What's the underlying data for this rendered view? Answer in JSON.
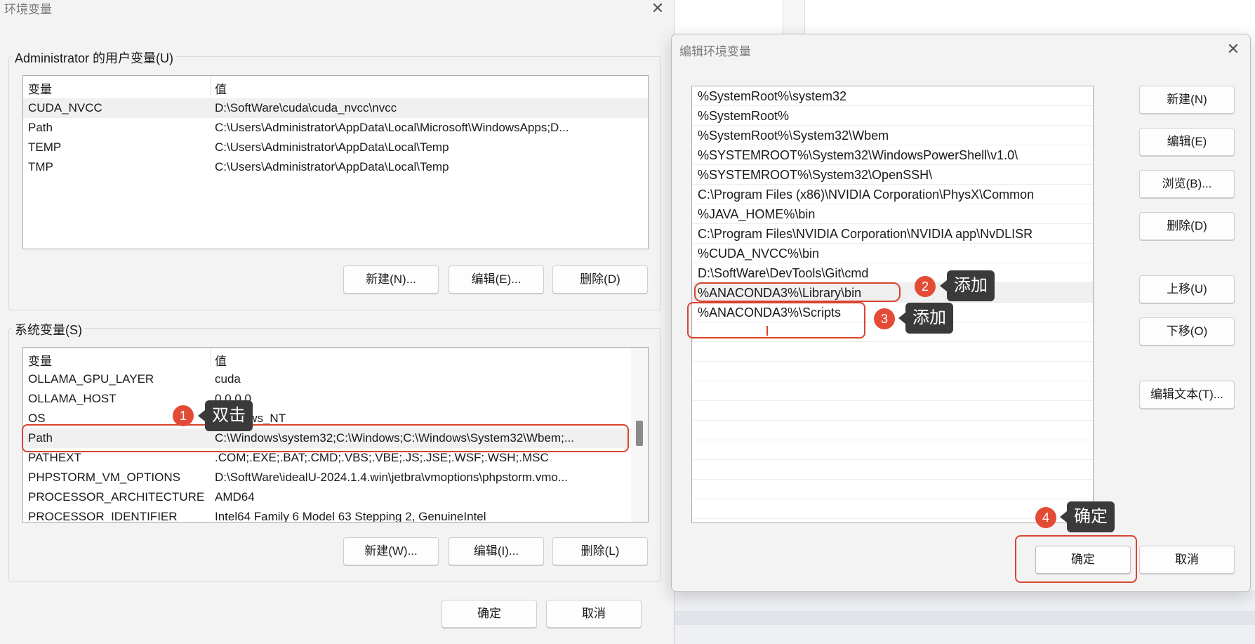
{
  "env_dialog": {
    "title": "环境变量",
    "close_icon": "✕",
    "user_group": {
      "legend": "Administrator 的用户变量(U)",
      "headers": [
        "变量",
        "值"
      ],
      "rows": [
        {
          "name": "CUDA_NVCC",
          "value": "D:\\SoftWare\\cuda\\cuda_nvcc\\nvcc"
        },
        {
          "name": "Path",
          "value": "C:\\Users\\Administrator\\AppData\\Local\\Microsoft\\WindowsApps;D..."
        },
        {
          "name": "TEMP",
          "value": "C:\\Users\\Administrator\\AppData\\Local\\Temp"
        },
        {
          "name": "TMP",
          "value": "C:\\Users\\Administrator\\AppData\\Local\\Temp"
        }
      ],
      "buttons": {
        "new": "新建(N)...",
        "edit": "编辑(E)...",
        "delete": "删除(D)"
      }
    },
    "system_group": {
      "legend": "系统变量(S)",
      "headers": [
        "变量",
        "值"
      ],
      "rows": [
        {
          "name": "OLLAMA_GPU_LAYER",
          "value": "cuda"
        },
        {
          "name": "OLLAMA_HOST",
          "value": "0.0.0.0"
        },
        {
          "name": "OS",
          "value": "Windows_NT"
        },
        {
          "name": "Path",
          "value": "C:\\Windows\\system32;C:\\Windows;C:\\Windows\\System32\\Wbem;..."
        },
        {
          "name": "PATHEXT",
          "value": ".COM;.EXE;.BAT;.CMD;.VBS;.VBE;.JS;.JSE;.WSF;.WSH;.MSC"
        },
        {
          "name": "PHPSTORM_VM_OPTIONS",
          "value": "D:\\SoftWare\\idealU-2024.1.4.win\\jetbra\\vmoptions\\phpstorm.vmo..."
        },
        {
          "name": "PROCESSOR_ARCHITECTURE",
          "value": "AMD64"
        },
        {
          "name": "PROCESSOR_IDENTIFIER",
          "value": "Intel64 Family 6 Model 63 Stepping 2, GenuineIntel"
        }
      ],
      "buttons": {
        "new": "新建(W)...",
        "edit": "编辑(I)...",
        "delete": "删除(L)"
      }
    },
    "ok": "确定",
    "cancel": "取消"
  },
  "edit_dialog": {
    "title": "编辑环境变量",
    "close_icon": "✕",
    "paths": [
      "%SystemRoot%\\system32",
      "%SystemRoot%",
      "%SystemRoot%\\System32\\Wbem",
      "%SYSTEMROOT%\\System32\\WindowsPowerShell\\v1.0\\",
      "%SYSTEMROOT%\\System32\\OpenSSH\\",
      "C:\\Program Files (x86)\\NVIDIA Corporation\\PhysX\\Common",
      "%JAVA_HOME%\\bin",
      "C:\\Program Files\\NVIDIA Corporation\\NVIDIA app\\NvDLISR",
      "%CUDA_NVCC%\\bin",
      "D:\\SoftWare\\DevTools\\Git\\cmd",
      "%ANACONDA3%\\Library\\bin",
      "%ANACONDA3%\\Scripts"
    ],
    "buttons": {
      "new": "新建(N)",
      "edit": "编辑(E)",
      "browse": "浏览(B)...",
      "delete": "删除(D)",
      "move_up": "上移(U)",
      "move_down": "下移(O)",
      "edit_text": "编辑文本(T)..."
    },
    "ok": "确定",
    "cancel": "取消"
  },
  "annotations": [
    {
      "number": "1",
      "text": "双击"
    },
    {
      "number": "2",
      "text": "添加"
    },
    {
      "number": "3",
      "text": "添加"
    },
    {
      "number": "4",
      "text": "确定"
    }
  ],
  "colors": {
    "annotation_red": "#d9432f",
    "badge_red": "#e44b36",
    "tooltip_bg": "#3a3a3a"
  }
}
